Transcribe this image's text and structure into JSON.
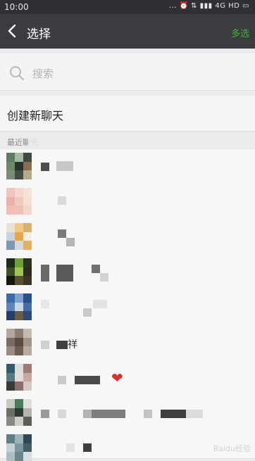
{
  "status_bar": {
    "time": "10:00",
    "indicators": "... ⏰ ⇅ ▮▮▮ 4G HD ▭"
  },
  "title_bar": {
    "title": "选择",
    "multi_select": "多选",
    "accent_color": "#3fb23b"
  },
  "search": {
    "placeholder": "搜索"
  },
  "new_chat": {
    "label": "创建新聊天"
  },
  "section": {
    "label": "最近聊天"
  },
  "rows": [
    {
      "name_fragment": "",
      "badge": ""
    },
    {
      "name_fragment": "",
      "badge": ""
    },
    {
      "name_fragment": "",
      "badge": ""
    },
    {
      "name_fragment": "",
      "badge": ""
    },
    {
      "name_fragment": "",
      "badge": ""
    },
    {
      "name_fragment": "祥",
      "badge": ""
    },
    {
      "name_fragment": "",
      "badge": "heart"
    },
    {
      "name_fragment": "",
      "badge": ""
    },
    {
      "name_fragment": "",
      "badge": ""
    }
  ],
  "watermark": "Baidu经验"
}
